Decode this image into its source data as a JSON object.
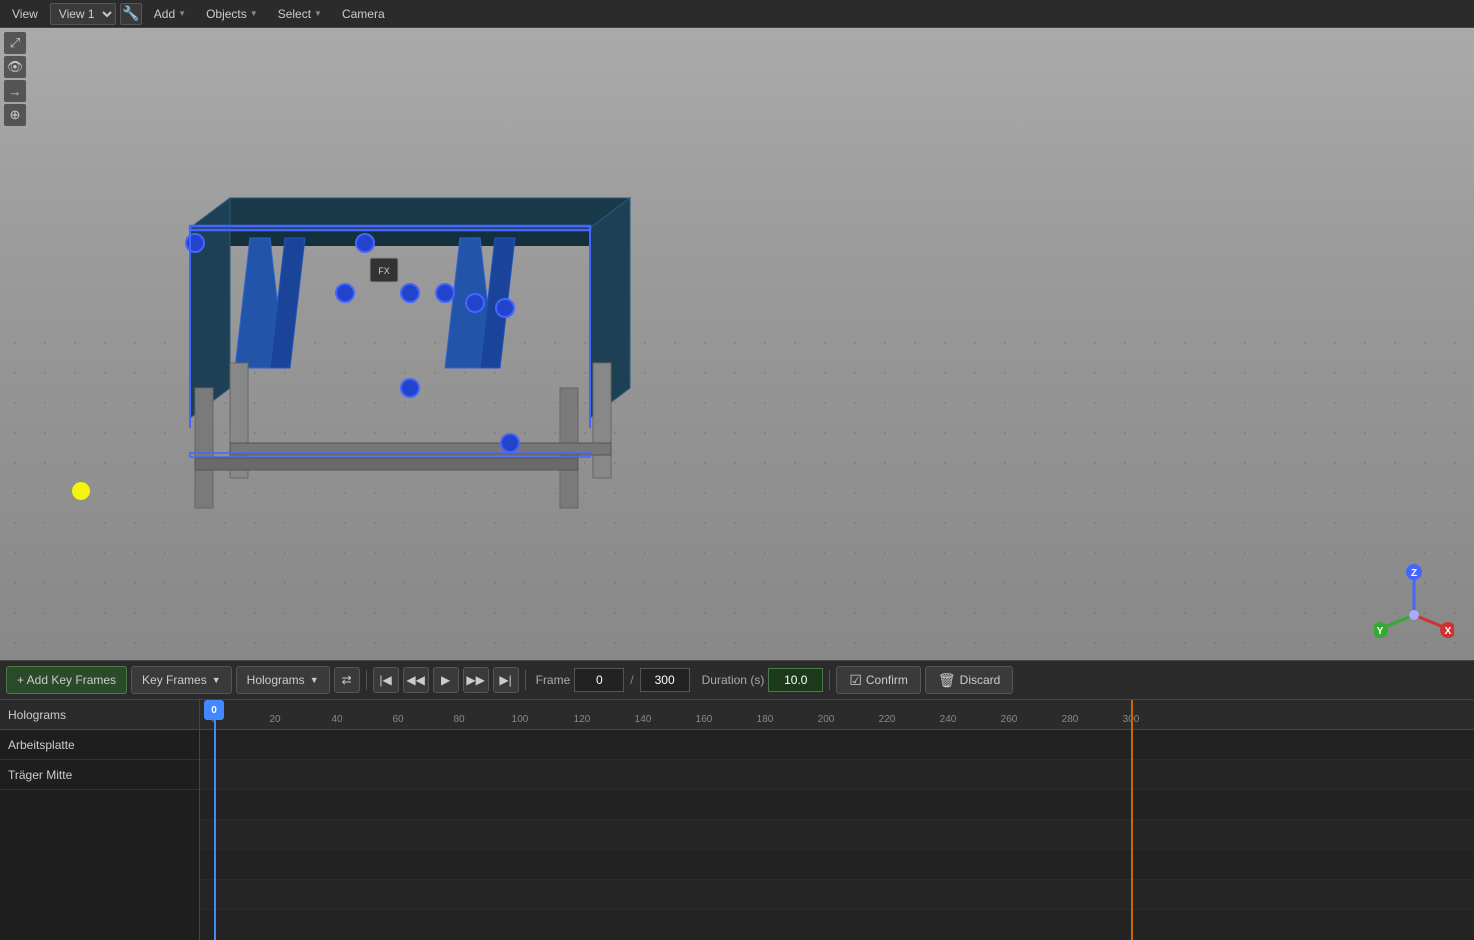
{
  "menu": {
    "view_label": "View",
    "view1_option": "View 1",
    "add_label": "Add",
    "objects_label": "Objects",
    "select_label": "Select",
    "camera_label": "Camera"
  },
  "toolbar": {
    "maximize_icon": "⤢",
    "eye_icon": "👁",
    "arrow_icon": "→",
    "crosshair_icon": "⊕"
  },
  "timeline": {
    "add_keyframes_label": "+ Add Key Frames",
    "keyframes_label": "Key Frames",
    "holograms_label": "Holograms",
    "sync_icon": "⇄",
    "frame_label": "Frame",
    "frame_value": "0",
    "frame_total": "300",
    "duration_label": "Duration (s)",
    "duration_value": "10.0",
    "confirm_label": "Confirm",
    "discard_label": "Discard"
  },
  "hologram_panel": {
    "header": "Holograms",
    "items": [
      {
        "name": "Arbeitsplatte"
      },
      {
        "name": "Träger Mitte"
      }
    ]
  },
  "ruler": {
    "marks": [
      0,
      20,
      40,
      60,
      80,
      100,
      120,
      140,
      160,
      180,
      200,
      220,
      240,
      260,
      280,
      300
    ]
  },
  "colors": {
    "accent_blue": "#4488ff",
    "accent_orange": "#cc6600",
    "confirm_bg": "#3a3a3a",
    "positive": "#2a4a2a"
  }
}
